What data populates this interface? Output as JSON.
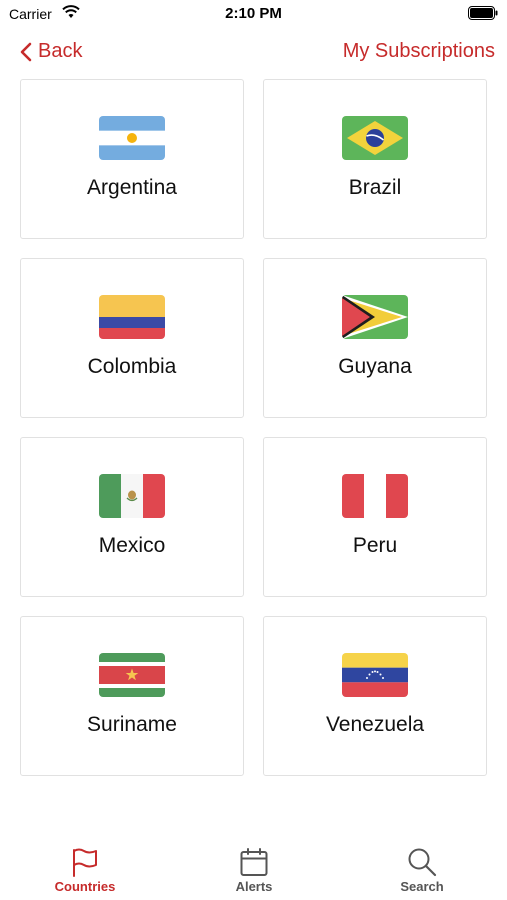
{
  "status_bar": {
    "carrier": "Carrier",
    "time": "2:10 PM"
  },
  "nav": {
    "back_label": "Back",
    "right_label": "My Subscriptions"
  },
  "countries": [
    {
      "name": "Argentina",
      "flag": "argentina-flag"
    },
    {
      "name": "Brazil",
      "flag": "brazil-flag"
    },
    {
      "name": "Colombia",
      "flag": "colombia-flag"
    },
    {
      "name": "Guyana",
      "flag": "guyana-flag"
    },
    {
      "name": "Mexico",
      "flag": "mexico-flag"
    },
    {
      "name": "Peru",
      "flag": "peru-flag"
    },
    {
      "name": "Suriname",
      "flag": "suriname-flag"
    },
    {
      "name": "Venezuela",
      "flag": "venezuela-flag"
    }
  ],
  "tabs": [
    {
      "label": "Countries",
      "icon": "flag-icon",
      "active": true
    },
    {
      "label": "Alerts",
      "icon": "calendar-icon",
      "active": false
    },
    {
      "label": "Search",
      "icon": "search-icon",
      "active": false
    }
  ],
  "colors": {
    "accent": "#c62b2b",
    "inactive": "#555555"
  }
}
